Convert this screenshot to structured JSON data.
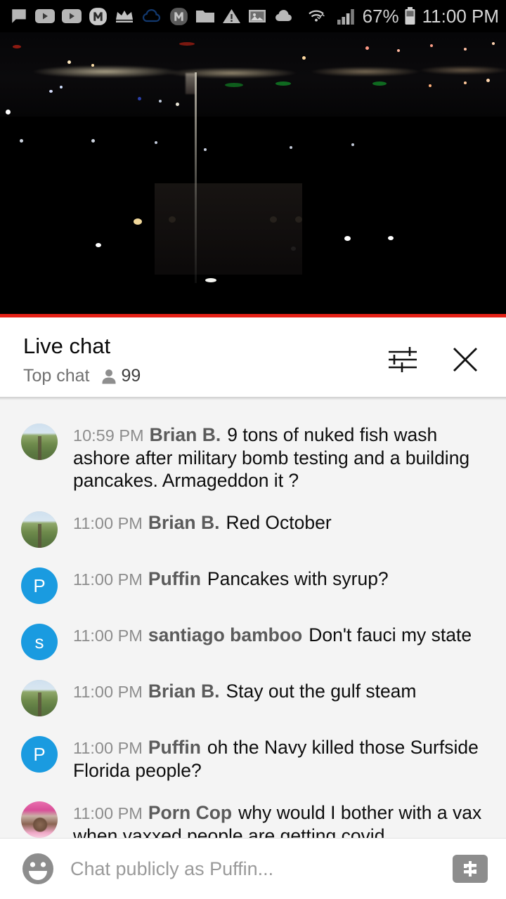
{
  "statusbar": {
    "icons": [
      "chat-bubble-icon",
      "youtube-play-icon",
      "youtube-play-icon",
      "m-badge-icon",
      "crown-icon",
      "cloud-outline-icon",
      "m-badge-dark-icon",
      "folder-icon",
      "warning-triangle-icon",
      "image-icon",
      "cloud-filled-icon"
    ],
    "wifi_icon": "wifi-data-icon",
    "signal_icon": "signal-bars-icon",
    "battery_percent": "67%",
    "battery_icon": "battery-icon",
    "clock": "11:00 PM"
  },
  "video": {
    "name": "live-stream-player",
    "description": "night cityscape with flagpole",
    "progress_color": "#e62117"
  },
  "chat_header": {
    "title": "Live chat",
    "subtitle": "Top chat",
    "viewer_icon": "person-icon",
    "viewer_count": "99",
    "settings_icon": "chat-settings-sliders-icon",
    "close_icon": "close-icon"
  },
  "messages": [
    {
      "time": "10:59 PM",
      "name": "Brian B.",
      "text": "9 tons of nuked fish wash ashore after military bomb testing and a building pancakes. Armageddon it ?",
      "avatar_type": "photo-landscape",
      "avatar_initial": "",
      "avatar_color": "#7b9a55"
    },
    {
      "time": "11:00 PM",
      "name": "Brian B.",
      "text": "Red October",
      "avatar_type": "photo-landscape",
      "avatar_initial": "",
      "avatar_color": "#7b9a55"
    },
    {
      "time": "11:00 PM",
      "name": "Puffin",
      "text": "Pancakes with syrup?",
      "avatar_type": "initial",
      "avatar_initial": "P",
      "avatar_color": "#1a9be0"
    },
    {
      "time": "11:00 PM",
      "name": "santiago bamboo",
      "text": "Don't fauci my state",
      "avatar_type": "initial",
      "avatar_initial": "s",
      "avatar_color": "#1a9be0"
    },
    {
      "time": "11:00 PM",
      "name": "Brian B.",
      "text": "Stay out the gulf steam",
      "avatar_type": "photo-landscape",
      "avatar_initial": "",
      "avatar_color": "#7b9a55"
    },
    {
      "time": "11:00 PM",
      "name": "Puffin",
      "text": "oh the Navy killed those Surfside Florida people?",
      "avatar_type": "initial",
      "avatar_initial": "P",
      "avatar_color": "#1a9be0"
    },
    {
      "time": "11:00 PM",
      "name": "Porn Cop",
      "text": "why would I bother with a vax when vaxxed people are getting covid",
      "avatar_type": "photo-cop",
      "avatar_initial": "",
      "avatar_color": "#d94f98"
    }
  ],
  "composer": {
    "emoji_icon": "emoji-smiley-icon",
    "placeholder": "Chat publicly as Puffin...",
    "value": "",
    "superchat_icon": "dollar-superchat-icon"
  }
}
